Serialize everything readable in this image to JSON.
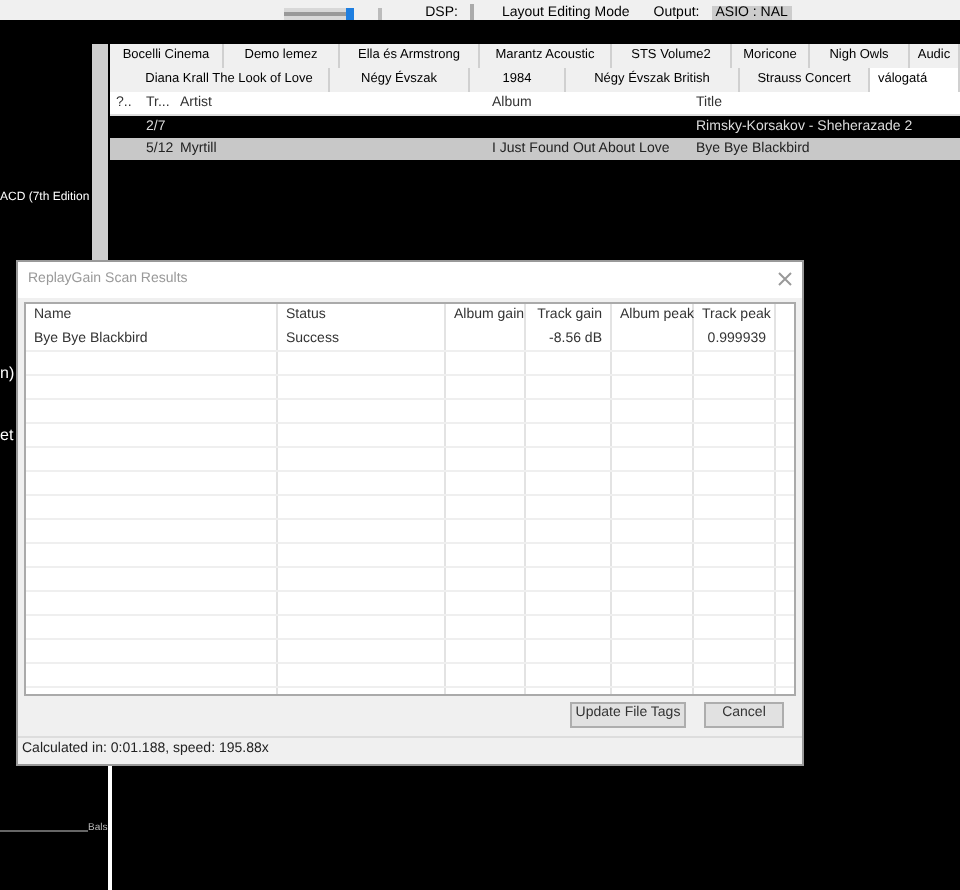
{
  "toolbar": {
    "volume": {
      "level": 0.9
    },
    "dsp_label": "DSP:",
    "layout_mode": "Layout Editing Mode",
    "output_label": "Output:",
    "output_value": "ASIO : NAL"
  },
  "left_panel": {
    "texts": [
      "ACD (7th Edition",
      "n)",
      "et"
    ],
    "axis_label": "Bals"
  },
  "tabs": [
    [
      {
        "label": "Bocelli Cinema",
        "selected": false
      },
      {
        "label": "Demo lemez",
        "selected": false
      },
      {
        "label": "Ella és Armstrong",
        "selected": false
      },
      {
        "label": "Marantz Acoustic",
        "selected": false
      },
      {
        "label": "STS Volume2",
        "selected": false
      },
      {
        "label": "Moricone",
        "selected": false
      },
      {
        "label": "Nigh Owls",
        "selected": false
      },
      {
        "label": "Audic",
        "selected": false
      }
    ],
    [
      {
        "label": "Diana Krall  The  Look of Love",
        "selected": false
      },
      {
        "label": "Négy Évszak",
        "selected": false
      },
      {
        "label": "1984",
        "selected": false
      },
      {
        "label": "Négy Évszak British",
        "selected": false
      },
      {
        "label": "Strauss Concert",
        "selected": false
      },
      {
        "label": "válogatá",
        "selected": true
      }
    ]
  ],
  "playlist": {
    "columns": [
      "?..",
      "Tr...",
      "Artist",
      "Album",
      "Title"
    ],
    "rows": [
      {
        "track": "2/7",
        "title": "Rimsky-Korsakov - Sheherazade 2",
        "selected": false
      },
      {
        "track": "5/12",
        "artist": "Myrtill",
        "album": "I Just Found Out About Love",
        "title": "Bye Bye Blackbird",
        "selected": true
      }
    ]
  },
  "dialog": {
    "title": "ReplayGain Scan Results",
    "columns": [
      "Name",
      "Status",
      "Album gain",
      "Track gain",
      "Album peak",
      "Track peak"
    ],
    "rows": [
      {
        "name": "Bye Bye Blackbird",
        "status": "Success",
        "track_gain": "-8.56 dB",
        "track_peak": "0.999939"
      }
    ],
    "buttons": [
      "Update File Tags",
      "Cancel"
    ],
    "status": "Calculated in: 0:01.188, speed: 195.88x"
  }
}
